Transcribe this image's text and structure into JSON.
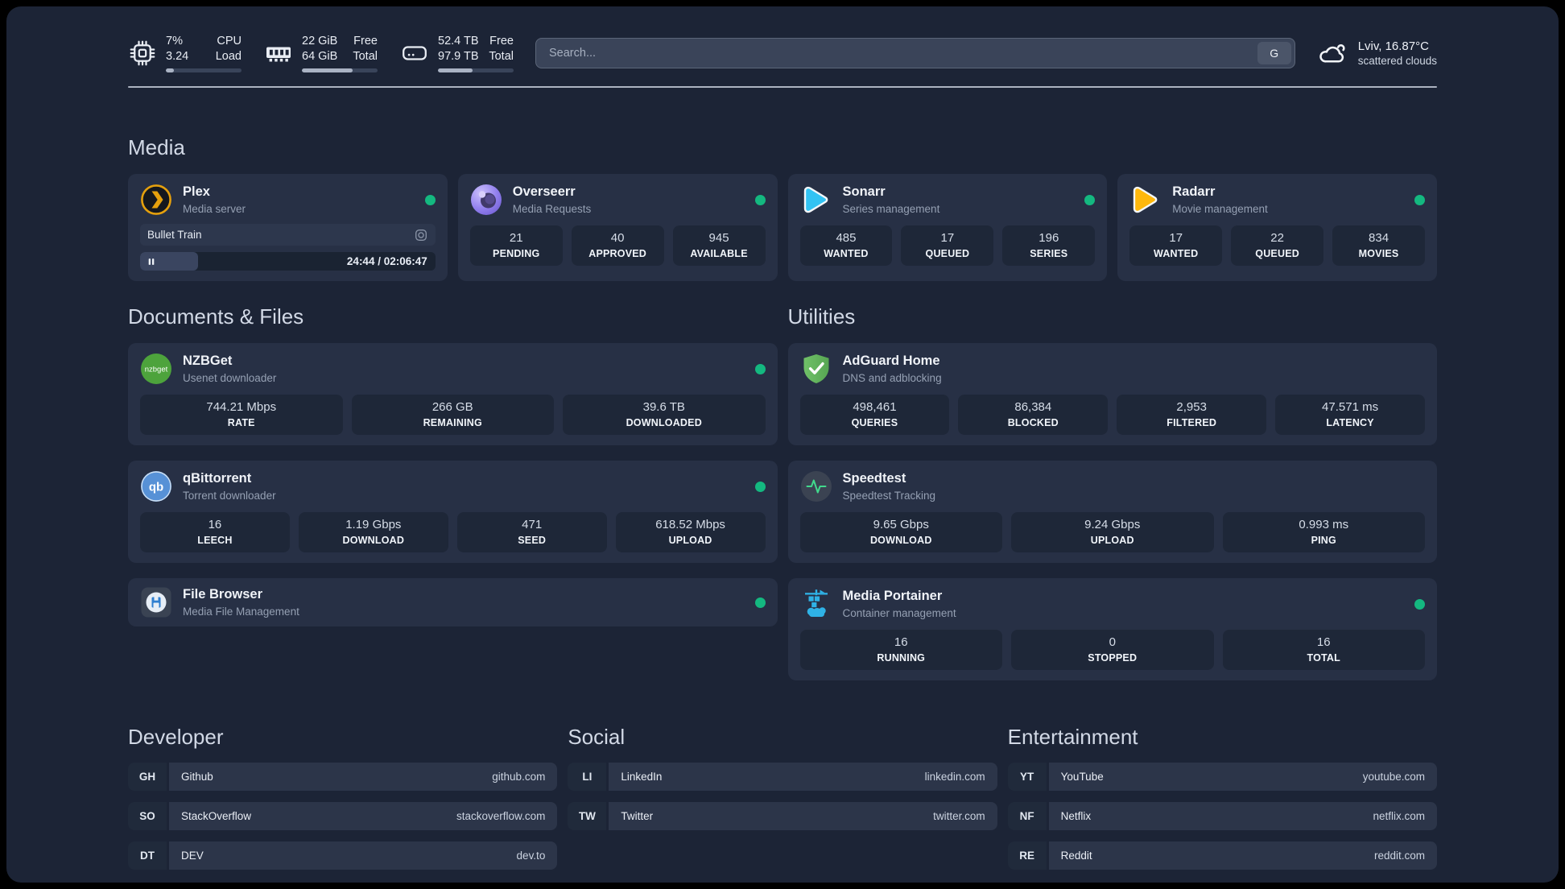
{
  "colors": {
    "background": "#1c2436",
    "card": "#273045",
    "stat_box": "#1e2738",
    "online_dot": "#14b880",
    "plex_accent": "#e5a00d",
    "overseerr_accent": "#9280ee",
    "sonarr_accent": "#32c3f3",
    "radarr_accent": "#ffb80c",
    "nzbget_accent": "#4da33c",
    "qbittorrent_accent": "#5791d6",
    "adguard_accent": "#63b45e",
    "speedtest_accent": "#41d98d",
    "portainer_accent": "#2fb2e6"
  },
  "topbar": {
    "stats": [
      {
        "id": "cpu",
        "icon": "cpu-chip-icon",
        "values": [
          "7%",
          "3.24"
        ],
        "labels": [
          "CPU",
          "Load"
        ],
        "progress_pct": 11
      },
      {
        "id": "memory",
        "icon": "ram-icon",
        "values": [
          "22 GiB",
          "64 GiB"
        ],
        "labels": [
          "Free",
          "Total"
        ],
        "progress_pct": 67
      },
      {
        "id": "storage",
        "icon": "disk-icon",
        "values": [
          "52.4 TB",
          "97.9 TB"
        ],
        "labels": [
          "Free",
          "Total"
        ],
        "progress_pct": 46
      }
    ],
    "search": {
      "placeholder": "Search...",
      "button_label": "G"
    },
    "weather": {
      "icon": "cloud-icon",
      "line1": "Lviv, 16.87°C",
      "line2": "scattered clouds"
    }
  },
  "media": {
    "title": "Media",
    "apps": [
      {
        "name": "Plex",
        "description": "Media server",
        "icon": "plex-icon",
        "online": true,
        "player": {
          "title": "Bullet Train",
          "time": "24:44 / 02:06:47",
          "progress_pct": 19.5
        }
      },
      {
        "name": "Overseerr",
        "description": "Media Requests",
        "icon": "overseerr-icon",
        "online": true,
        "stats": [
          {
            "value": "21",
            "label": "PENDING"
          },
          {
            "value": "40",
            "label": "APPROVED"
          },
          {
            "value": "945",
            "label": "AVAILABLE"
          }
        ]
      },
      {
        "name": "Sonarr",
        "description": "Series management",
        "icon": "sonarr-icon",
        "online": true,
        "stats": [
          {
            "value": "485",
            "label": "WANTED"
          },
          {
            "value": "17",
            "label": "QUEUED"
          },
          {
            "value": "196",
            "label": "SERIES"
          }
        ]
      },
      {
        "name": "Radarr",
        "description": "Movie management",
        "icon": "radarr-icon",
        "online": true,
        "stats": [
          {
            "value": "17",
            "label": "WANTED"
          },
          {
            "value": "22",
            "label": "QUEUED"
          },
          {
            "value": "834",
            "label": "MOVIES"
          }
        ]
      }
    ]
  },
  "documents": {
    "title": "Documents & Files",
    "apps": [
      {
        "name": "NZBGet",
        "description": "Usenet downloader",
        "icon": "nzbget-icon",
        "online": true,
        "stats": [
          {
            "value": "744.21 Mbps",
            "label": "RATE"
          },
          {
            "value": "266 GB",
            "label": "REMAINING"
          },
          {
            "value": "39.6 TB",
            "label": "DOWNLOADED"
          }
        ]
      },
      {
        "name": "qBittorrent",
        "description": "Torrent downloader",
        "icon": "qbittorrent-icon",
        "online": true,
        "stats": [
          {
            "value": "16",
            "label": "LEECH"
          },
          {
            "value": "1.19 Gbps",
            "label": "DOWNLOAD"
          },
          {
            "value": "471",
            "label": "SEED"
          },
          {
            "value": "618.52 Mbps",
            "label": "UPLOAD"
          }
        ]
      },
      {
        "name": "File Browser",
        "description": "Media File Management",
        "icon": "filebrowser-icon",
        "online": true
      }
    ]
  },
  "utilities": {
    "title": "Utilities",
    "apps": [
      {
        "name": "AdGuard Home",
        "description": "DNS and adblocking",
        "icon": "adguard-icon",
        "online": false,
        "stats": [
          {
            "value": "498,461",
            "label": "QUERIES"
          },
          {
            "value": "86,384",
            "label": "BLOCKED"
          },
          {
            "value": "2,953",
            "label": "FILTERED"
          },
          {
            "value": "47.571 ms",
            "label": "LATENCY"
          }
        ]
      },
      {
        "name": "Speedtest",
        "description": "Speedtest Tracking",
        "icon": "speedtest-icon",
        "online": false,
        "stats": [
          {
            "value": "9.65 Gbps",
            "label": "DOWNLOAD"
          },
          {
            "value": "9.24 Gbps",
            "label": "UPLOAD"
          },
          {
            "value": "0.993 ms",
            "label": "PING"
          }
        ]
      },
      {
        "name": "Media Portainer",
        "description": "Container management",
        "icon": "portainer-icon",
        "online": true,
        "stats": [
          {
            "value": "16",
            "label": "RUNNING"
          },
          {
            "value": "0",
            "label": "STOPPED"
          },
          {
            "value": "16",
            "label": "TOTAL"
          }
        ]
      }
    ]
  },
  "link_sections": [
    {
      "title": "Developer",
      "items": [
        {
          "abbr": "GH",
          "name": "Github",
          "url": "github.com"
        },
        {
          "abbr": "SO",
          "name": "StackOverflow",
          "url": "stackoverflow.com"
        },
        {
          "abbr": "DT",
          "name": "DEV",
          "url": "dev.to"
        }
      ]
    },
    {
      "title": "Social",
      "items": [
        {
          "abbr": "LI",
          "name": "LinkedIn",
          "url": "linkedin.com"
        },
        {
          "abbr": "TW",
          "name": "Twitter",
          "url": "twitter.com"
        }
      ]
    },
    {
      "title": "Entertainment",
      "items": [
        {
          "abbr": "YT",
          "name": "YouTube",
          "url": "youtube.com"
        },
        {
          "abbr": "NF",
          "name": "Netflix",
          "url": "netflix.com"
        },
        {
          "abbr": "RE",
          "name": "Reddit",
          "url": "reddit.com"
        }
      ]
    }
  ]
}
